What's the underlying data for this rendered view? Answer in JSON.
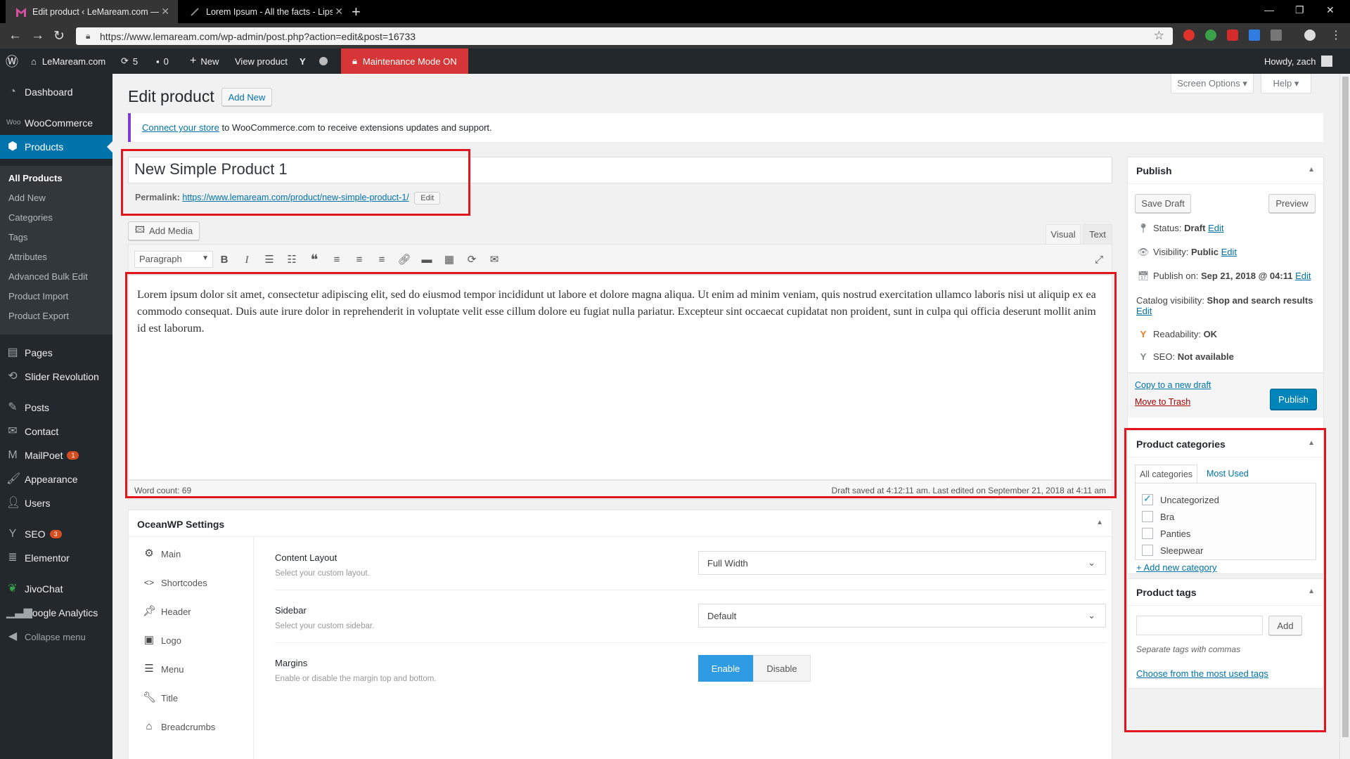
{
  "browser": {
    "tabs": [
      {
        "title": "Edit product ‹ LeMaream.com — "
      },
      {
        "title": "Lorem Ipsum - All the facts - Lips"
      }
    ],
    "url": "https://www.lemaream.com/wp-admin/post.php?action=edit&post=16733"
  },
  "adminbar": {
    "site_name": "LeMaream.com",
    "updates": "5",
    "comments": "0",
    "new_label": "New",
    "view_product": "View product",
    "maintenance": "Maintenance Mode ON",
    "howdy": "Howdy, zach"
  },
  "sidebar": {
    "items": [
      {
        "label": "Dashboard"
      },
      {
        "label": "WooCommerce"
      },
      {
        "label": "Products"
      },
      {
        "label": "Pages"
      },
      {
        "label": "Slider Revolution"
      },
      {
        "label": "Posts"
      },
      {
        "label": "Contact"
      },
      {
        "label": "MailPoet",
        "badge": "1"
      },
      {
        "label": "Appearance"
      },
      {
        "label": "Users"
      },
      {
        "label": "SEO",
        "badge": "3"
      },
      {
        "label": "Elementor"
      },
      {
        "label": "JivoChat"
      },
      {
        "label": "Google Analytics"
      },
      {
        "label": "Collapse menu"
      }
    ],
    "submenu": [
      "All Products",
      "Add New",
      "Categories",
      "Tags",
      "Attributes",
      "Advanced Bulk Edit",
      "Product Import",
      "Product Export"
    ]
  },
  "header": {
    "title": "Edit product",
    "add_new": "Add New",
    "screen_options": "Screen Options",
    "help": "Help"
  },
  "notice": {
    "link": "Connect your store",
    "text": " to WooCommerce.com to receive extensions updates and support."
  },
  "post": {
    "title": "New Simple Product 1",
    "permalink_label": "Permalink:",
    "permalink_url": "https://www.lemaream.com/product/new-simple-product-1/",
    "permalink_edit": "Edit"
  },
  "editor": {
    "add_media": "Add Media",
    "tab_visual": "Visual",
    "tab_text": "Text",
    "format": "Paragraph",
    "content": "Lorem ipsum dolor sit amet, consectetur adipiscing elit, sed do eiusmod tempor incididunt ut labore et dolore magna aliqua. Ut enim ad minim veniam, quis nostrud exercitation ullamco laboris nisi ut aliquip ex ea commodo consequat. Duis aute irure dolor in reprehenderit in voluptate velit esse cillum dolore eu fugiat nulla pariatur. Excepteur sint occaecat cupidatat non proident, sunt in culpa qui officia deserunt mollit anim id est laborum.",
    "word_count": "Word count: 69",
    "draft_status": "Draft saved at 4:12:11 am. Last edited on September 21, 2018 at 4:11 am"
  },
  "oceanwp": {
    "title": "OceanWP Settings",
    "tabs": [
      "Main",
      "Shortcodes",
      "Header",
      "Logo",
      "Menu",
      "Title",
      "Breadcrumbs"
    ],
    "fields": [
      {
        "label": "Content Layout",
        "desc": "Select your custom layout.",
        "value": "Full Width"
      },
      {
        "label": "Sidebar",
        "desc": "Select your custom sidebar.",
        "value": "Default"
      },
      {
        "label": "Margins",
        "desc": "Enable or disable the margin top and bottom.",
        "enable": "Enable",
        "disable": "Disable"
      }
    ]
  },
  "publish": {
    "title": "Publish",
    "save_draft": "Save Draft",
    "preview": "Preview",
    "status_label": "Status:",
    "status_value": "Draft",
    "visibility_label": "Visibility:",
    "visibility_value": "Public",
    "publish_on_label": "Publish on:",
    "publish_on_value": "Sep 21, 2018 @ 04:11",
    "catalog_label": "Catalog visibility:",
    "catalog_value": "Shop and search results",
    "readability_label": "Readability:",
    "readability_value": "OK",
    "seo_label": "SEO:",
    "seo_value": "Not available",
    "edit": "Edit",
    "copy_draft": "Copy to a new draft",
    "trash": "Move to Trash",
    "publish_btn": "Publish"
  },
  "categories": {
    "title": "Product categories",
    "tab_all": "All categories",
    "tab_most": "Most Used",
    "items": [
      {
        "label": "Uncategorized",
        "checked": true
      },
      {
        "label": "Bra",
        "checked": false
      },
      {
        "label": "Panties",
        "checked": false
      },
      {
        "label": "Sleepwear",
        "checked": false
      }
    ],
    "add_new": "+ Add new category"
  },
  "tags": {
    "title": "Product tags",
    "add": "Add",
    "hint": "Separate tags with commas",
    "choose": "Choose from the most used tags"
  },
  "colors": {
    "accent": "#0073aa",
    "highlight": "#e2151f",
    "maintenance": "#d63638"
  }
}
